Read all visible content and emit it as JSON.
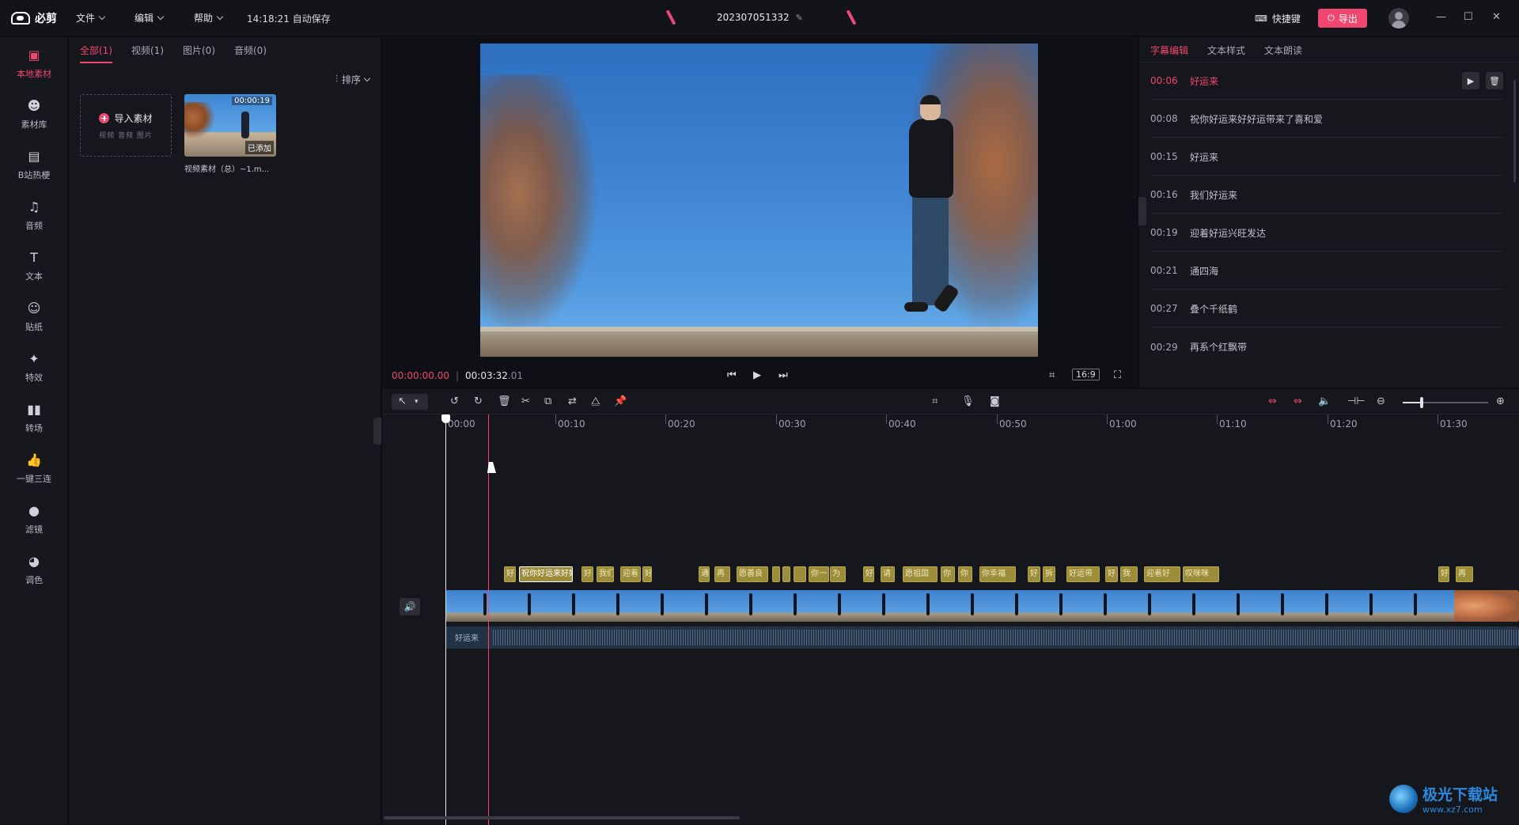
{
  "titlebar": {
    "app_name": "必剪",
    "menus": [
      "文件",
      "编辑",
      "帮助"
    ],
    "autosave": "14:18:21 自动保存",
    "project_name": "202307051332",
    "shortcut_label": "快捷键",
    "export_label": "导出"
  },
  "sidebar": {
    "items": [
      {
        "label": "本地素材",
        "icon": "folder-icon",
        "active": true
      },
      {
        "label": "素材库",
        "icon": "library-icon"
      },
      {
        "label": "B站热梗",
        "icon": "bilibili-icon"
      },
      {
        "label": "音频",
        "icon": "music-icon"
      },
      {
        "label": "文本",
        "icon": "text-icon"
      },
      {
        "label": "贴纸",
        "icon": "sticker-icon"
      },
      {
        "label": "特效",
        "icon": "effects-icon"
      },
      {
        "label": "转场",
        "icon": "transition-icon"
      },
      {
        "label": "一键三连",
        "icon": "thumb-up-icon"
      },
      {
        "label": "滤镜",
        "icon": "filter-icon"
      },
      {
        "label": "调色",
        "icon": "palette-icon"
      }
    ]
  },
  "media": {
    "tabs": [
      "全部(1)",
      "视频(1)",
      "图片(0)",
      "音频(0)"
    ],
    "sort_label": "排序",
    "import_title": "导入素材",
    "import_sub": "视频 音频 图片",
    "clip": {
      "duration": "00:00:19",
      "status": "已添加",
      "name": "视频素材（总）~1.m..."
    }
  },
  "player": {
    "current_time": "00:00:00.00",
    "total_time": "00:03:32",
    "total_frames": ".01",
    "ratio": "16:9"
  },
  "subtitle_panel": {
    "tabs": [
      "字幕编辑",
      "文本样式",
      "文本朗读"
    ],
    "rows": [
      {
        "time": "00:06",
        "text": "好运来"
      },
      {
        "time": "00:08",
        "text": "祝你好运来好好运带来了喜和爱"
      },
      {
        "time": "00:15",
        "text": "好运来"
      },
      {
        "time": "00:16",
        "text": "我们好运来"
      },
      {
        "time": "00:19",
        "text": "迎着好运兴旺发达"
      },
      {
        "time": "00:21",
        "text": "通四海"
      },
      {
        "time": "00:27",
        "text": "叠个千纸鹤"
      },
      {
        "time": "00:29",
        "text": "再系个红飘带"
      }
    ]
  },
  "timeline": {
    "ruler_labels": [
      "00:00",
      "00:10",
      "00:20",
      "00:30",
      "00:40",
      "00:50",
      "01:00",
      "01:10",
      "01:20",
      "01:30"
    ],
    "subtitle_chips": [
      "好",
      "祝你好运来好好",
      "好",
      "我们",
      "迎着",
      "好",
      "通",
      "再",
      "愿善良",
      "",
      "",
      "",
      "你一",
      "为",
      "好",
      "请",
      "愿祖国",
      "你",
      "你",
      "你幸福",
      "好",
      "拆",
      "好运带",
      "好",
      "我",
      "迎着好",
      "叹咪咪",
      "好",
      "再"
    ],
    "audio_label": "好运来"
  },
  "watermark": {
    "cn": "极光下载站",
    "url": "www.xz7.com"
  }
}
